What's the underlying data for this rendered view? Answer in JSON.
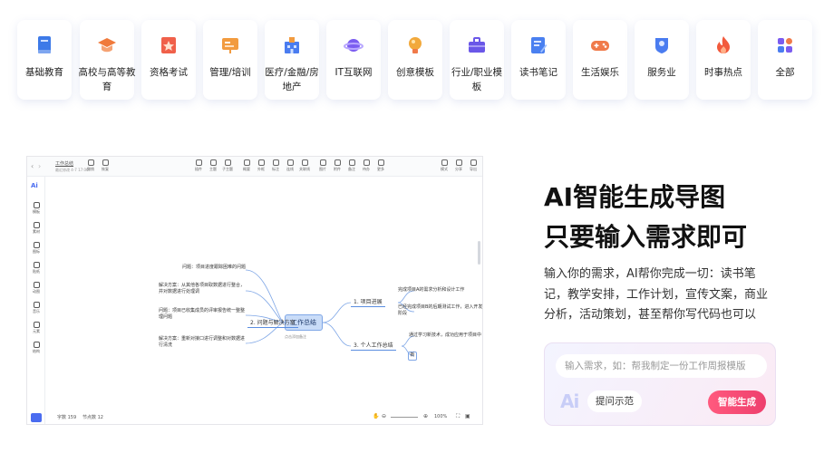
{
  "categories": [
    {
      "label": "基础教育",
      "icon": "book-icon",
      "color": "#3d7ae8"
    },
    {
      "label": "高校与高等教育",
      "icon": "graduation-cap-icon",
      "color": "#f07a3c"
    },
    {
      "label": "资格考试",
      "icon": "star-certificate-icon",
      "color": "#f0604a"
    },
    {
      "label": "管理/培训",
      "icon": "presentation-board-icon",
      "color": "#f29b3f"
    },
    {
      "label": "医疗/金融/房地产",
      "icon": "building-icon",
      "color": "#4a7cf0"
    },
    {
      "label": "IT互联网",
      "icon": "planet-icon",
      "color": "#7b5cf0"
    },
    {
      "label": "创意模板",
      "icon": "lightbulb-icon",
      "color": "#f2a93c"
    },
    {
      "label": "行业/职业模板",
      "icon": "briefcase-icon",
      "color": "#6a57e8"
    },
    {
      "label": "读书笔记",
      "icon": "notebook-pen-icon",
      "color": "#4a80f0"
    },
    {
      "label": "生活娱乐",
      "icon": "gamepad-icon",
      "color": "#f07a4a"
    },
    {
      "label": "服务业",
      "icon": "service-badge-icon",
      "color": "#4a7cf0"
    },
    {
      "label": "时事热点",
      "icon": "flame-icon",
      "color": "#f25a3c"
    },
    {
      "label": "全部",
      "icon": "grid-apps-icon",
      "color": "#7b5cf0"
    }
  ],
  "hero": {
    "title1": "AI智能生成导图",
    "title2": "只要输入需求即可",
    "desc": "输入你的需求，AI帮你完成一切：读书笔记，教学安排，工作计划，宣传文案，商业分析，活动策划，甚至帮你写代码也可以"
  },
  "generator": {
    "placeholder": "输入需求，如：帮我制定一份工作周报模版",
    "ai_mark": "Ai",
    "hint_label": "提问示范",
    "generate_label": "智能生成"
  },
  "app": {
    "doc_title": "工作总结",
    "doc_sub": "最近修改 4-7 17:06",
    "toolbar_left": [
      "撤销",
      "恢复"
    ],
    "toolbar_mid": [
      "插件",
      "主题",
      "子主题",
      "概要",
      "外框",
      "标注",
      "连线",
      "关联线",
      "图片",
      "附件",
      "备注",
      "待办",
      "更多"
    ],
    "toolbar_right": [
      "模式",
      "分享",
      "导出"
    ],
    "sidebar": [
      "模板",
      "素材",
      "图标",
      "贴纸",
      "动图",
      "音乐",
      "元素",
      "结构"
    ],
    "root": "工作总结",
    "root_note": "点击添加备注",
    "branch_left": "2. 问题与解决方案",
    "branch_right1": "1. 项目进展",
    "branch_right2": "3. 个人工作总结",
    "left_leaves": [
      "问题：项目进度跟踪困难的问题",
      "解决方案：从其他各项目取数据进行整合，并对数据进行处理调",
      "问题：项目已收集成员的评审报告统一整整理问题",
      "解决方案：重新对接口进行调整和对数据进行清洗"
    ],
    "right_leaves1": [
      "完成项目A的需求分析和设计工作",
      "已经完成项目B的后期测试工作，进入开发阶段"
    ],
    "right_leaves2": [
      "通过学习新技术，成功应用于项目中"
    ],
    "small_node": "新",
    "word_count": "字数 159",
    "node_count": "节点数 12",
    "zoom": "100%"
  }
}
